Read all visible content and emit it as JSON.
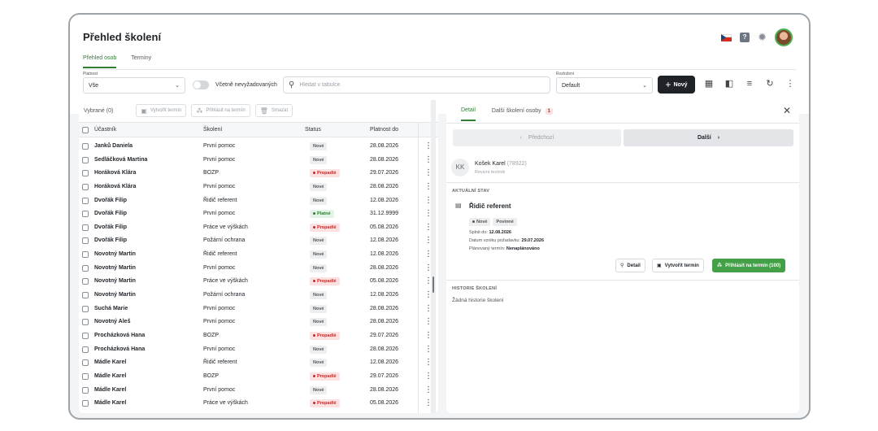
{
  "page_title": "Přehled školení",
  "tabs": [
    {
      "label": "Přehled osob",
      "active": true
    },
    {
      "label": "Termíny",
      "active": false
    }
  ],
  "filters": {
    "platnost_label": "Platnost",
    "platnost_value": "Vše",
    "toggle_label": "Včetně nevyžadovaných",
    "search_placeholder": "Hledat v tabulce",
    "rozlozeni_label": "Rozložení",
    "rozlozeni_value": "Default",
    "new_button": "Nový"
  },
  "toolbar": {
    "selected": "Vybrané (0)",
    "create": "Vytvořit termín",
    "enroll": "Přihlásit na termín",
    "delete": "Smazat"
  },
  "table": {
    "headers": [
      "Účastník",
      "Školení",
      "Status",
      "Platnost do"
    ],
    "rows": [
      [
        "Janků Daniela",
        "První pomoc",
        "Nové",
        "28.08.2026"
      ],
      [
        "Sedláčková Martina",
        "První pomoc",
        "Nové",
        "28.08.2026"
      ],
      [
        "Horáková Klára",
        "BOZP",
        "Propadlé",
        "29.07.2026"
      ],
      [
        "Horáková Klára",
        "První pomoc",
        "Nové",
        "28.08.2026"
      ],
      [
        "Dvořák Filip",
        "Řidič referent",
        "Nové",
        "12.08.2026"
      ],
      [
        "Dvořák Filip",
        "První pomoc",
        "Platné",
        "31.12.9999"
      ],
      [
        "Dvořák Filip",
        "Práce ve výškách",
        "Propadlé",
        "05.08.2026"
      ],
      [
        "Dvořák Filip",
        "Požární ochrana",
        "Nové",
        "12.08.2026"
      ],
      [
        "Novotný Martin",
        "Řidič referent",
        "Nové",
        "12.08.2026"
      ],
      [
        "Novotný Martin",
        "První pomoc",
        "Nové",
        "28.08.2026"
      ],
      [
        "Novotný Martin",
        "Práce ve výškách",
        "Propadlé",
        "05.08.2026"
      ],
      [
        "Novotný Martin",
        "Požární ochrana",
        "Nové",
        "12.08.2026"
      ],
      [
        "Suchá Marie",
        "První pomoc",
        "Nové",
        "28.08.2026"
      ],
      [
        "Novotný Aleš",
        "První pomoc",
        "Nové",
        "28.08.2026"
      ],
      [
        "Procházková Hana",
        "BOZP",
        "Propadlé",
        "29.07.2026"
      ],
      [
        "Procházková Hana",
        "První pomoc",
        "Nové",
        "28.08.2026"
      ],
      [
        "Mádle Karel",
        "Řidič referent",
        "Nové",
        "12.08.2026"
      ],
      [
        "Mádle Karel",
        "BOZP",
        "Propadlé",
        "29.07.2026"
      ],
      [
        "Mádle Karel",
        "První pomoc",
        "Nové",
        "28.08.2026"
      ],
      [
        "Mádle Karel",
        "Práce ve výškách",
        "Propadlé",
        "05.08.2026"
      ]
    ]
  },
  "detail": {
    "tab_detail": "Detail",
    "tab_other": "Další školení osoby",
    "other_count": "1",
    "prev": "Předchozí",
    "next": "Další",
    "initials": "KK",
    "person_name": "Košek Karel",
    "person_id": "(78922)",
    "person_role": "Revizní technik",
    "current_state_label": "AKTUÁLNÍ STAV",
    "course": "Řidič referent",
    "pill_new": "Nové",
    "pill_required": "Povinné",
    "deadline_label": "Splnit do:",
    "deadline_value": "12.08.2026",
    "created_label": "Datum vzniku požadavku:",
    "created_value": "29.07.2026",
    "planned_label": "Plánovaný termín:",
    "planned_value": "Nenaplánováno",
    "btn_detail": "Detail",
    "btn_create": "Vytvořit termín",
    "btn_enroll": "Přihlásit na termín (100)",
    "history_label": "HISTORIE ŠKOLENÍ",
    "no_history": "Žádná historie školení"
  },
  "colors": {
    "accent": "#2f7d32",
    "danger": "#c62828",
    "dark_button": "#1f2328"
  }
}
